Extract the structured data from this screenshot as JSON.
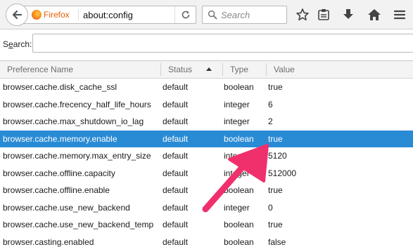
{
  "toolbar": {
    "identity_label": "Firefox",
    "url": "about:config",
    "search_placeholder": "Search"
  },
  "config_search": {
    "label_prefix": "S",
    "label_underlined": "e",
    "label_suffix": "arch:",
    "value": ""
  },
  "table": {
    "columns": [
      "Preference Name",
      "Status",
      "Type",
      "Value"
    ],
    "sorted_column": "Status",
    "rows": [
      {
        "name": "browser.cache.disk_cache_ssl",
        "status": "default",
        "type": "boolean",
        "value": "true"
      },
      {
        "name": "browser.cache.frecency_half_life_hours",
        "status": "default",
        "type": "integer",
        "value": "6"
      },
      {
        "name": "browser.cache.max_shutdown_io_lag",
        "status": "default",
        "type": "integer",
        "value": "2"
      },
      {
        "name": "browser.cache.memory.enable",
        "status": "default",
        "type": "boolean",
        "value": "true"
      },
      {
        "name": "browser.cache.memory.max_entry_size",
        "status": "default",
        "type": "integer",
        "value": "5120"
      },
      {
        "name": "browser.cache.offline.capacity",
        "status": "default",
        "type": "integer",
        "value": "512000"
      },
      {
        "name": "browser.cache.offline.enable",
        "status": "default",
        "type": "boolean",
        "value": "true"
      },
      {
        "name": "browser.cache.use_new_backend",
        "status": "default",
        "type": "integer",
        "value": "0"
      },
      {
        "name": "browser.cache.use_new_backend_temp",
        "status": "default",
        "type": "boolean",
        "value": "true"
      },
      {
        "name": "browser.casting.enabled",
        "status": "default",
        "type": "boolean",
        "value": "false"
      }
    ],
    "selected_row": "browser.cache.memory.enable"
  },
  "colors": {
    "selection": "#2a8bd5",
    "annotation_arrow": "#f0306d",
    "firefox_label": "#e66000"
  },
  "icons": [
    "back-arrow-icon",
    "firefox-logo-icon",
    "reload-icon",
    "search-icon",
    "bookmark-star-icon",
    "reading-list-icon",
    "download-icon",
    "home-icon",
    "menu-icon"
  ]
}
